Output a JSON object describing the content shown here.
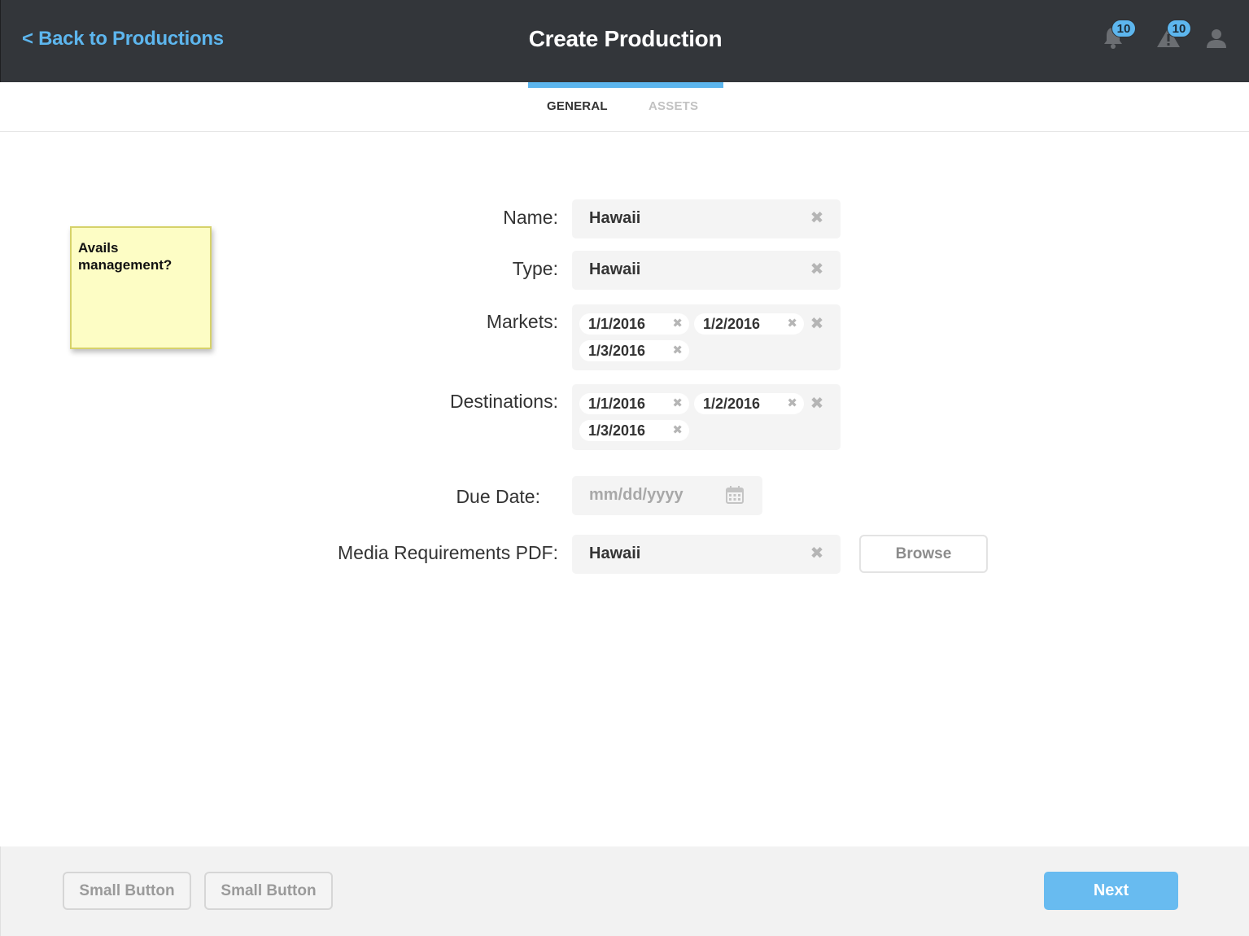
{
  "header": {
    "back_label": "< Back to Productions",
    "title": "Create Production",
    "notifications_count": "10",
    "alerts_count": "10"
  },
  "tabs": [
    {
      "label": "GENERAL",
      "active": true
    },
    {
      "label": "ASSETS",
      "active": false
    }
  ],
  "sticky_note": {
    "text": "Avails management?"
  },
  "form": {
    "name": {
      "label": "Name:",
      "value": "Hawaii"
    },
    "type": {
      "label": "Type:",
      "value": "Hawaii"
    },
    "markets": {
      "label": "Markets:",
      "chips": [
        "1/1/2016",
        "1/2/2016",
        "1/3/2016"
      ]
    },
    "destinations": {
      "label": "Destinations:",
      "chips": [
        "1/1/2016",
        "1/2/2016",
        "1/3/2016"
      ]
    },
    "due_date": {
      "label": "Due Date:",
      "placeholder": "mm/dd/yyyy"
    },
    "media_pdf": {
      "label": "Media Requirements PDF:",
      "value": "Hawaii",
      "browse_label": "Browse"
    }
  },
  "footer": {
    "buttons": [
      "Small Button",
      "Small Button"
    ],
    "next_label": "Next"
  },
  "colors": {
    "accent": "#5db6ee",
    "header_bg": "#33363a",
    "next_button": "#68bbf0",
    "sticky_bg": "#fdfdc5"
  },
  "icons": {
    "notifications": "bell-icon",
    "alerts": "warning-icon",
    "user": "user-icon",
    "clear": "close-icon",
    "calendar": "calendar-icon"
  }
}
